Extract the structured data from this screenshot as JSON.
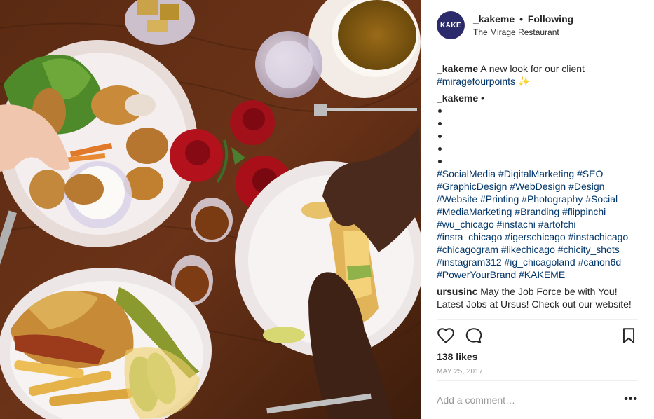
{
  "post": {
    "image_alt_icon": "food-photo",
    "colors": {
      "link": "#003569",
      "avatar_bg": "#2b2a6b",
      "muted": "#999999"
    }
  },
  "header": {
    "avatar_text": "KAKE",
    "username": "_kakeme",
    "separator": "•",
    "follow_status": "Following",
    "location": "The Mirage Restaurant"
  },
  "caption": {
    "username": "_kakeme",
    "text": "A new look for our client",
    "tag": "#miragefourpoints",
    "emoji": "✨"
  },
  "comment1": {
    "username": "_kakeme",
    "separator": "•",
    "bullet_count": 5,
    "hashtags": [
      "#SocialMedia",
      "#DigitalMarketing",
      "#SEO",
      "#GraphicDesign",
      "#WebDesign",
      "#Design",
      "#Website",
      "#Printing",
      "#Photography",
      "#Social",
      "#MediaMarketing",
      "#Branding",
      "#flippinchi",
      "#wu_chicago",
      "#instachi",
      "#artofchi",
      "#insta_chicago",
      "#igerschicago",
      "#instachicago",
      "#chicagogram",
      "#likechicago",
      "#chicity_shots",
      "#instagram312",
      "#ig_chicagoland",
      "#canon6d",
      "#PowerYourBrand",
      "#KAKEME"
    ]
  },
  "comment2": {
    "username": "ursusinc",
    "text": "May the Job Force be with You! Latest Jobs at Ursus! Check out our website!"
  },
  "actions": {
    "like_icon": "heart-icon",
    "comment_icon": "comment-icon",
    "save_icon": "bookmark-icon"
  },
  "likes": "138 likes",
  "date": "MAY 25, 2017",
  "add_comment": {
    "placeholder": "Add a comment…",
    "more": "•••"
  }
}
